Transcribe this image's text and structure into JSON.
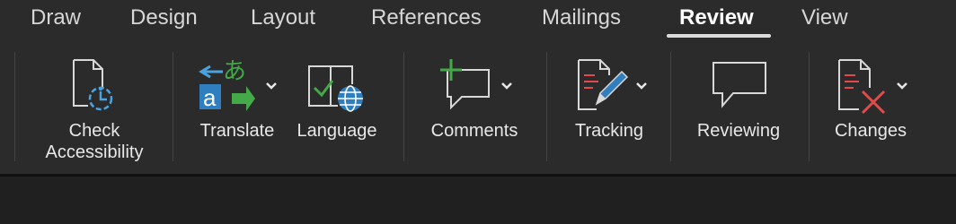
{
  "tabs": {
    "draw": "Draw",
    "design": "Design",
    "layout": "Layout",
    "references": "References",
    "mailings": "Mailings",
    "review": "Review",
    "view": "View"
  },
  "tools": {
    "check_accessibility_line1": "Check",
    "check_accessibility_line2": "Accessibility",
    "translate": "Translate",
    "language": "Language",
    "comments": "Comments",
    "tracking": "Tracking",
    "reviewing": "Reviewing",
    "changes": "Changes"
  },
  "colors": {
    "accent_blue": "#4aa3df",
    "accent_green": "#44a948",
    "accent_red": "#e14b4b",
    "icon_stroke": "#d8d8d8"
  }
}
